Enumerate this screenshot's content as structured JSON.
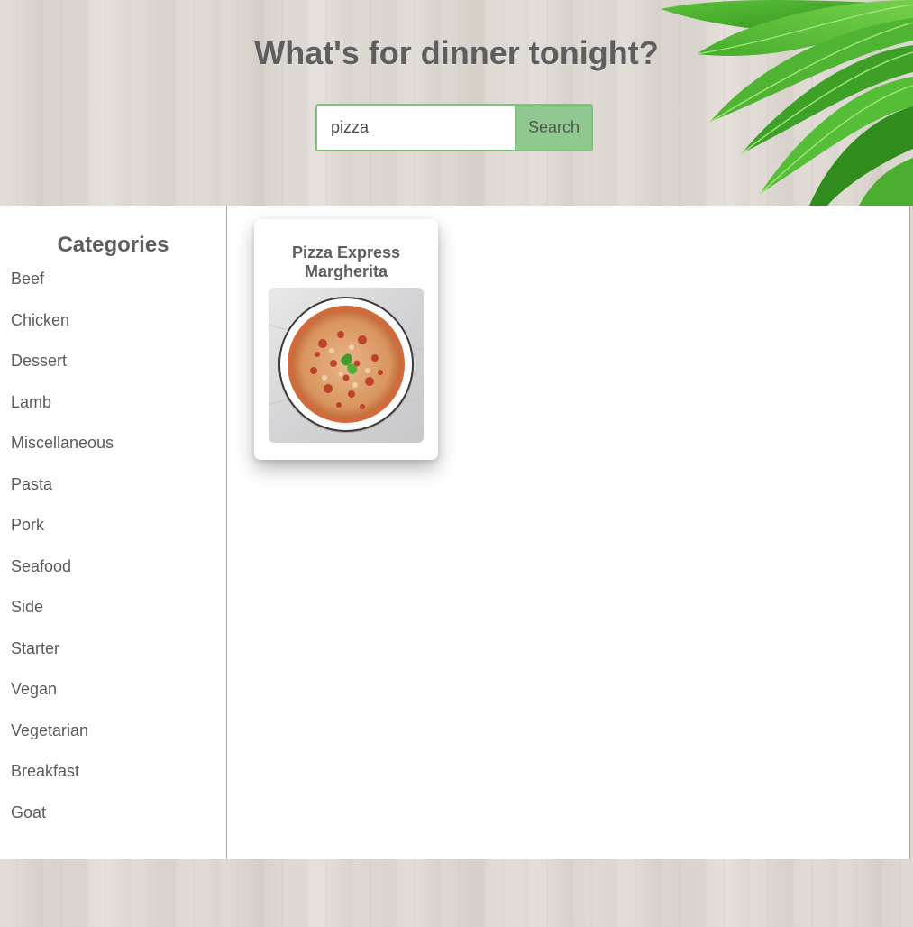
{
  "header": {
    "headline": "What's for dinner tonight?",
    "search": {
      "value": "pizza",
      "placeholder": "",
      "button_label": "Search"
    }
  },
  "sidebar": {
    "title": "Categories",
    "categories": [
      "Beef",
      "Chicken",
      "Dessert",
      "Lamb",
      "Miscellaneous",
      "Pasta",
      "Pork",
      "Seafood",
      "Side",
      "Starter",
      "Vegan",
      "Vegetarian",
      "Breakfast",
      "Goat"
    ]
  },
  "results": {
    "meals": [
      {
        "name": "Pizza Express Margherita"
      }
    ]
  },
  "colors": {
    "accent_green": "#7cc47c",
    "button_green": "#8fc98f",
    "text_gray": "#5e5e5e"
  }
}
